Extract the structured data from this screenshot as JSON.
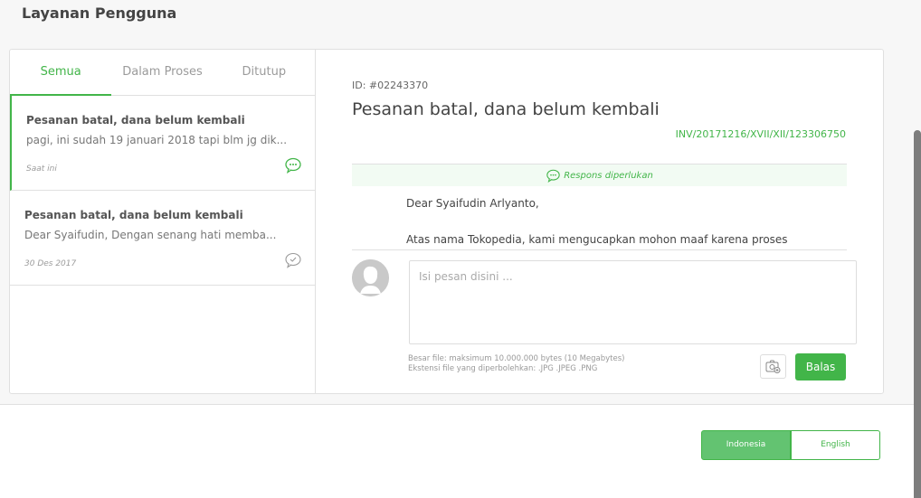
{
  "page": {
    "title": "Layanan Pengguna"
  },
  "colors": {
    "accent": "#42b549",
    "accent_light": "#63c371",
    "status_bg": "#f2fbf3"
  },
  "tabs": [
    {
      "label": "Semua",
      "active": true
    },
    {
      "label": "Dalam Proses",
      "active": false
    },
    {
      "label": "Ditutup",
      "active": false
    }
  ],
  "tickets": [
    {
      "title": "Pesanan batal, dana belum kembali",
      "snippet": "pagi, ini sudah 19 januari 2018 tapi blm jg dik...",
      "date": "Saat ini",
      "icon": "chat-pending-icon",
      "active": true
    },
    {
      "title": "Pesanan batal, dana belum kembali",
      "snippet": "Dear Syaifudin, Dengan senang hati memba...",
      "date": "30 Des 2017",
      "icon": "chat-resolved-icon",
      "active": false
    }
  ],
  "detail": {
    "id": "ID: #02243370",
    "title": "Pesanan batal, dana belum kembali",
    "invoice": "INV/20171216/XVII/XII/123306750",
    "status": "Respons diperlukan",
    "message": {
      "greeting": "Dear Syaifudin Arlyanto,",
      "body": "Atas nama Tokopedia, kami mengucapkan mohon maaf karena proses"
    },
    "reply": {
      "placeholder": "Isi pesan disini ...",
      "value": "",
      "file_info_size": "Besar file: maksimum 10.000.000 bytes (10 Megabytes)",
      "file_info_ext": "Ekstensi file yang diperbolehkan: .JPG .JPEG .PNG",
      "send_label": "Balas"
    }
  },
  "footer": {
    "languages": [
      {
        "label": "Indonesia",
        "active": true
      },
      {
        "label": "English",
        "active": false
      }
    ]
  }
}
